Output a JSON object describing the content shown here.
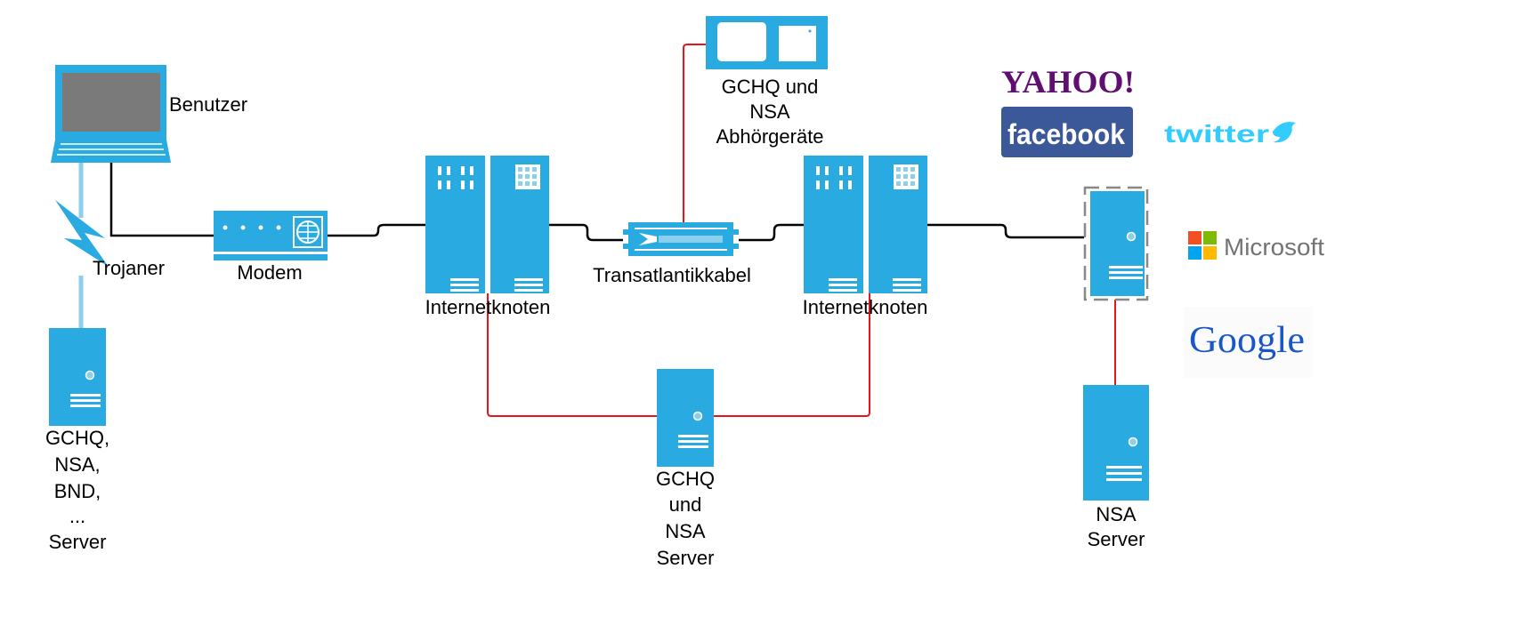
{
  "colors": {
    "device": "#29abe2",
    "wire": "#000000",
    "tap_line": "#e8131b",
    "wireless": "#8ccfec"
  },
  "nodes": {
    "user": {
      "label": "Benutzer",
      "icon": "laptop-icon"
    },
    "trojan": {
      "label": "Trojaner",
      "icon": "lightning-icon"
    },
    "agency_server": {
      "lines": [
        "GCHQ,",
        "NSA,",
        "BND,",
        "...",
        "Server"
      ],
      "icon": "server-icon"
    },
    "modem": {
      "label": "Modem",
      "icon": "modem-icon"
    },
    "node1": {
      "label": "Internetknoten",
      "icon": "server-rack-icon"
    },
    "cable": {
      "label": "Transatlantikkabel",
      "icon": "cable-icon"
    },
    "tap_device": {
      "lines": [
        "GCHQ und",
        "NSA",
        "Abhörgeräte"
      ],
      "icon": "tap-device-icon"
    },
    "node2": {
      "label": "Internetknoten",
      "icon": "server-rack-icon"
    },
    "gchq_nsa_server": {
      "lines": [
        "GCHQ",
        "und",
        "NSA",
        "Server"
      ],
      "icon": "server-icon"
    },
    "provider_server": {
      "icon": "server-icon"
    },
    "nsa_server": {
      "lines": [
        "NSA",
        "Server"
      ],
      "icon": "server-icon"
    }
  },
  "logos": {
    "yahoo": "YAHOO!",
    "facebook": "facebook",
    "twitter": "twitter",
    "microsoft": "Microsoft",
    "google": "Google"
  }
}
